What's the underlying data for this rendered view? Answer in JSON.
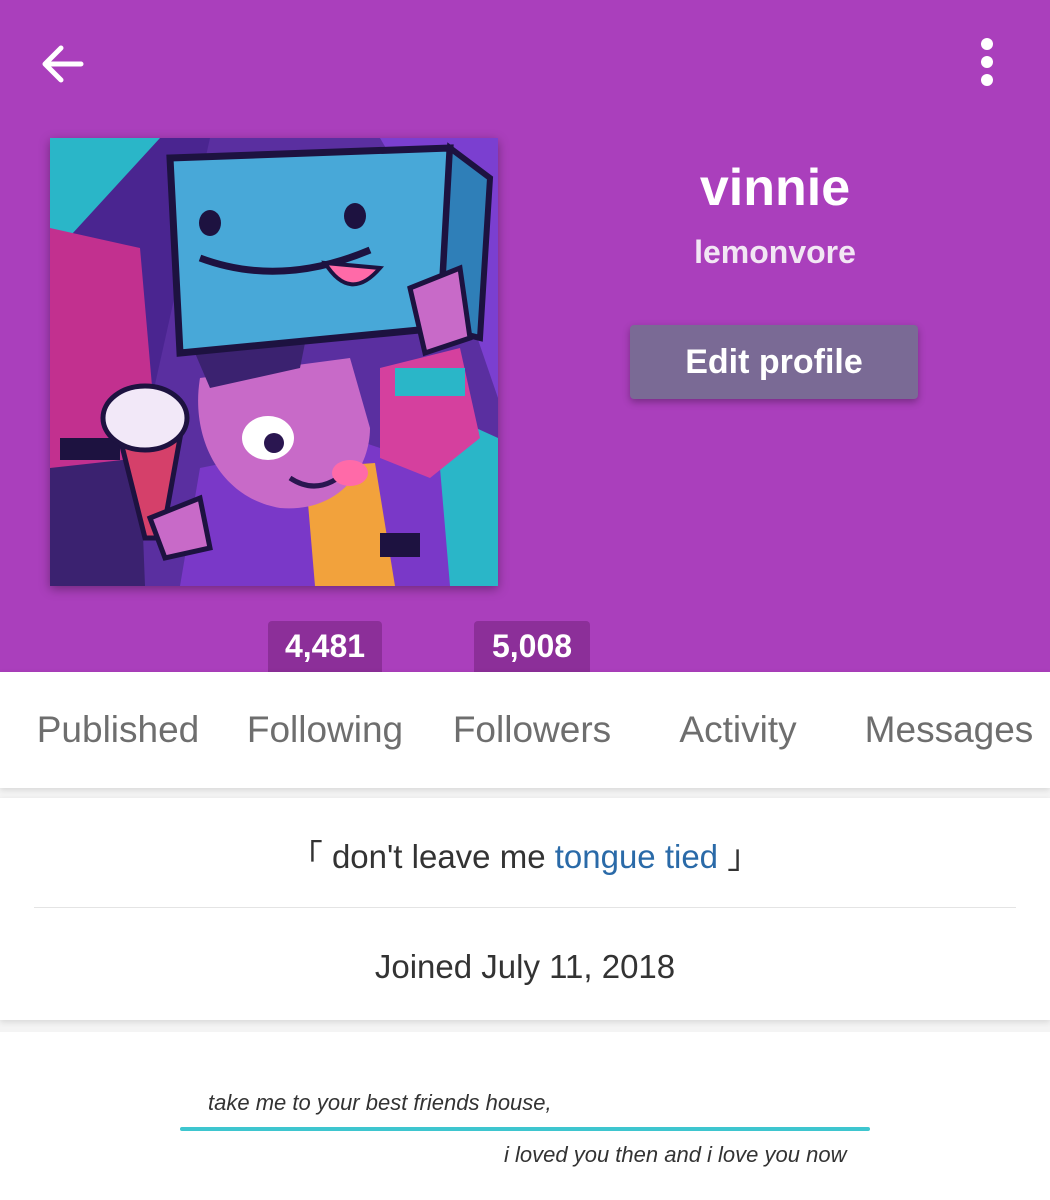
{
  "header": {
    "background_color": "#aa3fbc",
    "back_icon": "arrow-left-icon",
    "more_icon": "more-vertical-icon"
  },
  "profile": {
    "display_name": "vinnie",
    "username": "lemonvore",
    "edit_button_label": "Edit profile",
    "avatar_icon": "avatar-illustration"
  },
  "counts": {
    "following": "4,481",
    "followers": "5,008"
  },
  "tabs": [
    {
      "label": "Published"
    },
    {
      "label": "Following"
    },
    {
      "label": "Followers"
    },
    {
      "label": "Activity"
    },
    {
      "label": "Messages"
    }
  ],
  "about": {
    "bio_open": "「 don't leave me ",
    "bio_link": "tongue tied",
    "bio_close": " 」",
    "joined": "Joined July 11, 2018",
    "link_color": "#2a6aa8"
  },
  "quote": {
    "line1": "take me to your best friends house,",
    "line2": "i loved you then and i love you now",
    "accent_color": "#3ec6cf"
  }
}
